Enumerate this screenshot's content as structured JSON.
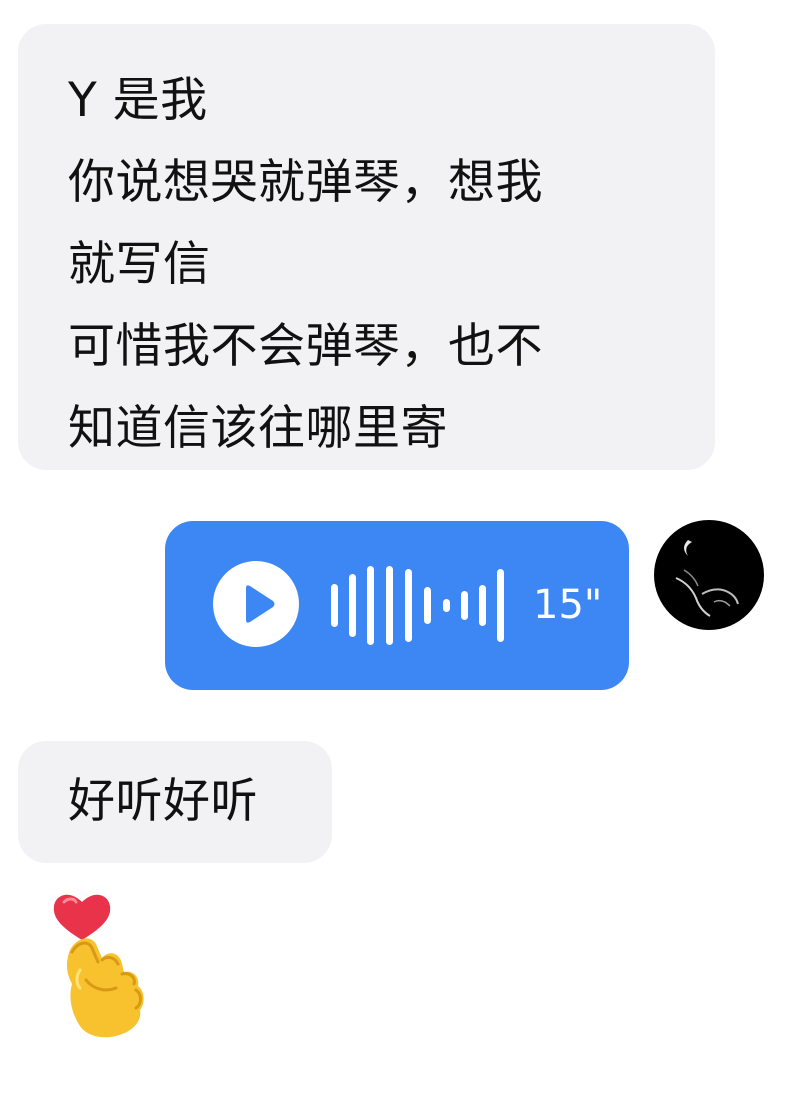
{
  "messages": {
    "first": {
      "lines": [
        "Y 是我",
        "你说想哭就弹琴，想我",
        "就写信",
        "可惜我不会弹琴，也不",
        "知道信该往哪里寄"
      ]
    },
    "voice": {
      "duration": "15\"",
      "icon": "play-icon",
      "color": "#3d87f5"
    },
    "second": {
      "text": "好听好听"
    },
    "sticker": {
      "icon": "heart-hand-icon"
    }
  },
  "colors": {
    "incoming_bubble": "#f2f2f4",
    "outgoing_voice": "#3d87f5",
    "text": "#111111"
  }
}
